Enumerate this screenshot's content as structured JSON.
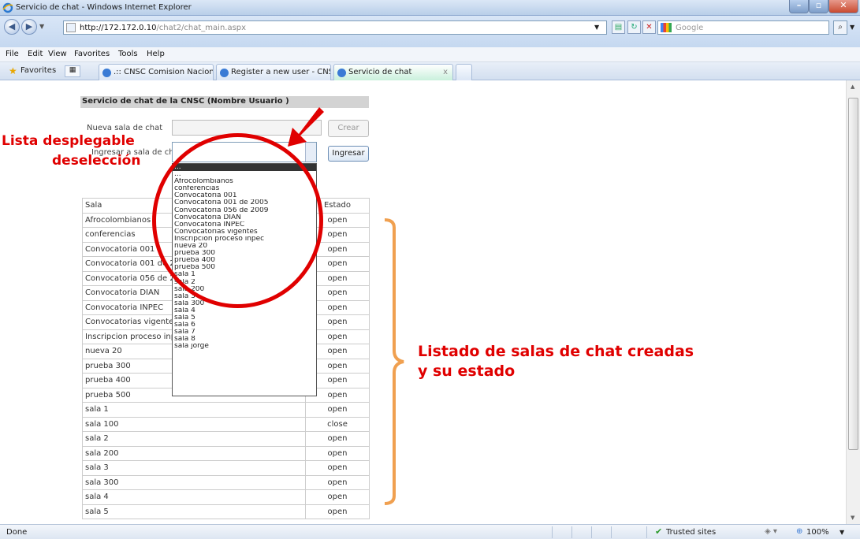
{
  "window": {
    "title": "Servicio de chat - Windows Internet Explorer"
  },
  "address": {
    "url_host": "http://172.172.0.10",
    "url_path": "/chat2/chat_main.aspx",
    "search_placeholder": "Google"
  },
  "menu": [
    "File",
    "Edit",
    "View",
    "Favorites",
    "Tools",
    "Help"
  ],
  "favorites": {
    "label": "Favorites"
  },
  "tabs": [
    {
      "label": ".:: CNSC Comision Nacion..."
    },
    {
      "label": "Register a new user - CNSC"
    },
    {
      "label": "Servicio de chat",
      "close": "x"
    }
  ],
  "page": {
    "heading": "Servicio de chat de la CNSC (Nombre Usuario )",
    "new_room_label": "Nueva sala de chat",
    "create_button": "Crear",
    "enter_room_label": "Ingresar a sala de chat",
    "select_value": "...",
    "enter_button": "Ingresar",
    "table_headers": [
      "Sala",
      "Estado"
    ],
    "rooms": [
      [
        "Afrocolombianos",
        "open"
      ],
      [
        "conferencias",
        "open"
      ],
      [
        "Convocatoria 001",
        "open"
      ],
      [
        "Convocatoria 001 de 2005",
        "open"
      ],
      [
        "Convocatoria 056 de 2009",
        "open"
      ],
      [
        "Convocatoria DIAN",
        "open"
      ],
      [
        "Convocatoria INPEC",
        "open"
      ],
      [
        "Convocatorias vigentes",
        "open"
      ],
      [
        "Inscripcion proceso inpec",
        "open"
      ],
      [
        "nueva 20",
        "open"
      ],
      [
        "prueba 300",
        "open"
      ],
      [
        "prueba 400",
        "open"
      ],
      [
        "prueba 500",
        "open"
      ],
      [
        "sala 1",
        "open"
      ],
      [
        "sala 100",
        "close"
      ],
      [
        "sala 2",
        "open"
      ],
      [
        "sala 200",
        "open"
      ],
      [
        "sala 3",
        "open"
      ],
      [
        "sala 300",
        "open"
      ],
      [
        "sala 4",
        "open"
      ],
      [
        "sala 5",
        "open"
      ]
    ],
    "dropdown_options": [
      "...",
      "...",
      "Afrocolombianos",
      "conferencias",
      "Convocatoria 001",
      "Convocatoria 001 de 2005",
      "Convocatoria 056 de 2009",
      "Convocatoria DIAN",
      "Convocatoria INPEC",
      "Convocatorias vigentes",
      "Inscripcion proceso inpec",
      "nueva 20",
      "prueba 300",
      "prueba 400",
      "prueba 500",
      "sala 1",
      "sala 2",
      "sala 200",
      "sala 3",
      "sala 300",
      "sala 4",
      "sala 5",
      "sala 6",
      "sala 7",
      "sala 8",
      "sala jorge"
    ]
  },
  "annotations": {
    "dropdown_line1": "Lista desplegable",
    "dropdown_line2": "deselección",
    "list_line1": "Listado de salas de chat creadas",
    "list_line2": "y su estado",
    "annotation_color": "#e00000",
    "bracket_color": "#f0a050"
  },
  "status": {
    "left": "Done",
    "zone": "Trusted sites",
    "zoom": "100%"
  }
}
